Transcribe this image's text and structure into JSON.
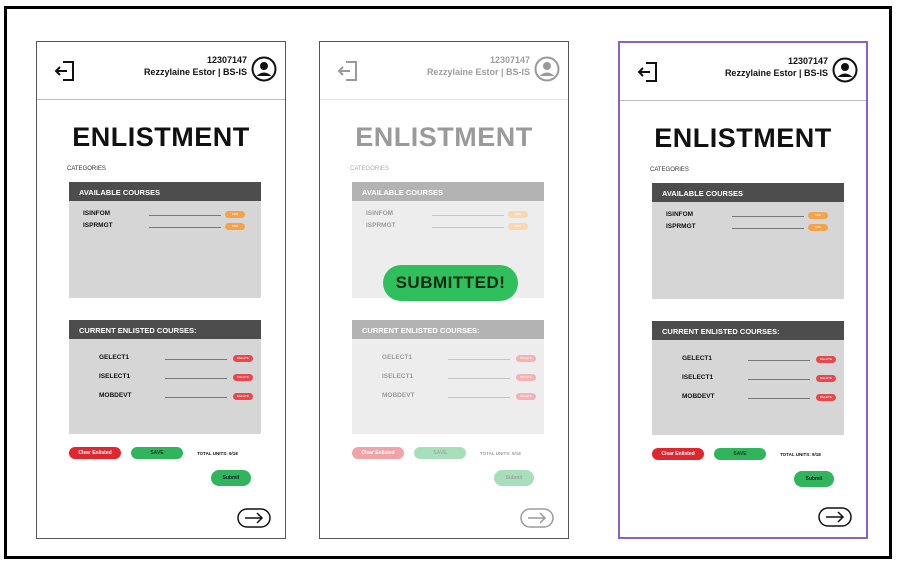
{
  "header": {
    "student_id": "12307147",
    "student_name": "Rezzylaine Estor | BS-IS"
  },
  "page": {
    "title": "ENLISTMENT",
    "categories_label": "CATEGORIES"
  },
  "available_panel": {
    "title": "AVAILABLE COURSES",
    "courses": [
      "ISINFOM",
      "ISPRMGT"
    ],
    "add_label": "ADD"
  },
  "current_panel": {
    "title": "CURRENT ENLISTED COURSES:",
    "courses": [
      "GELECT1",
      "ISELECT1",
      "MOBDEVT"
    ],
    "delete_label": "DELETE"
  },
  "actions": {
    "clear_label": "Clear Enlisted",
    "save_label": "SAVE",
    "total_units": "TOTAL UNITS: 9/18",
    "submit_label": "Submit"
  },
  "overlay": {
    "submitted_text": "SUBMITTED!"
  },
  "colors": {
    "red": "#e0262f",
    "green": "#30b45c",
    "orange": "#f5a24a",
    "panel_header": "#4d4d4d",
    "panel_body": "#d6d6d6",
    "selected_border": "#8a5fd0"
  }
}
